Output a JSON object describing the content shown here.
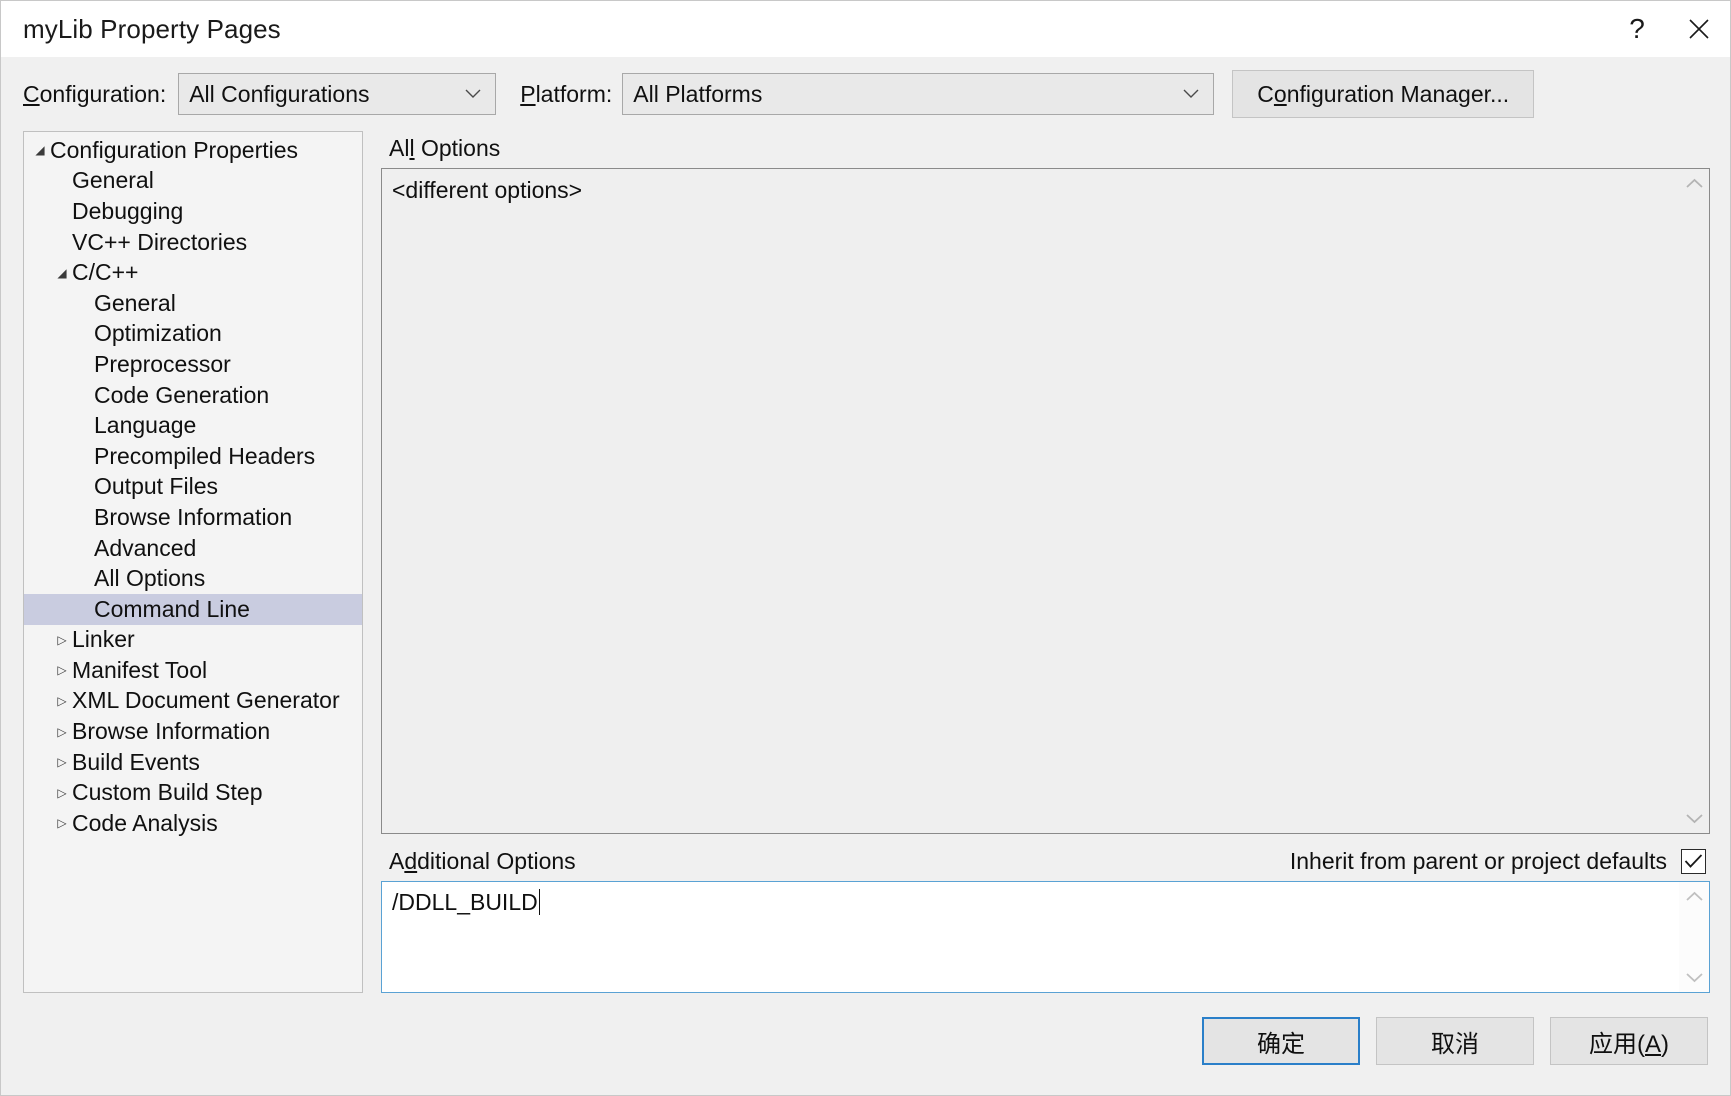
{
  "window": {
    "title": "myLib Property Pages",
    "help_icon": "question-mark-icon",
    "close_icon": "close-icon"
  },
  "config_bar": {
    "configuration_label": "Configuration:",
    "configuration_label_acc": "C",
    "configuration_value": "All Configurations",
    "platform_label": "Platform:",
    "platform_label_acc": "P",
    "platform_value": "All Platforms",
    "configuration_manager_label_pre": "C",
    "configuration_manager_label_acc": "o",
    "configuration_manager_label_post": "nfiguration Manager...",
    "dropdown_icon": "chevron-down-icon"
  },
  "tree": {
    "items": [
      {
        "label": "Configuration Properties",
        "indent": 0,
        "state": "expanded",
        "selected": false
      },
      {
        "label": "General",
        "indent": 1,
        "state": "leaf",
        "selected": false
      },
      {
        "label": "Debugging",
        "indent": 1,
        "state": "leaf",
        "selected": false
      },
      {
        "label": "VC++ Directories",
        "indent": 1,
        "state": "leaf",
        "selected": false
      },
      {
        "label": "C/C++",
        "indent": 1,
        "state": "expanded",
        "selected": false
      },
      {
        "label": "General",
        "indent": 2,
        "state": "leaf",
        "selected": false
      },
      {
        "label": "Optimization",
        "indent": 2,
        "state": "leaf",
        "selected": false
      },
      {
        "label": "Preprocessor",
        "indent": 2,
        "state": "leaf",
        "selected": false
      },
      {
        "label": "Code Generation",
        "indent": 2,
        "state": "leaf",
        "selected": false
      },
      {
        "label": "Language",
        "indent": 2,
        "state": "leaf",
        "selected": false
      },
      {
        "label": "Precompiled Headers",
        "indent": 2,
        "state": "leaf",
        "selected": false
      },
      {
        "label": "Output Files",
        "indent": 2,
        "state": "leaf",
        "selected": false
      },
      {
        "label": "Browse Information",
        "indent": 2,
        "state": "leaf",
        "selected": false
      },
      {
        "label": "Advanced",
        "indent": 2,
        "state": "leaf",
        "selected": false
      },
      {
        "label": "All Options",
        "indent": 2,
        "state": "leaf",
        "selected": false
      },
      {
        "label": "Command Line",
        "indent": 2,
        "state": "leaf",
        "selected": true
      },
      {
        "label": "Linker",
        "indent": 1,
        "state": "collapsed",
        "selected": false
      },
      {
        "label": "Manifest Tool",
        "indent": 1,
        "state": "collapsed",
        "selected": false
      },
      {
        "label": "XML Document Generator",
        "indent": 1,
        "state": "collapsed",
        "selected": false
      },
      {
        "label": "Browse Information",
        "indent": 1,
        "state": "collapsed",
        "selected": false
      },
      {
        "label": "Build Events",
        "indent": 1,
        "state": "collapsed",
        "selected": false
      },
      {
        "label": "Custom Build Step",
        "indent": 1,
        "state": "collapsed",
        "selected": false
      },
      {
        "label": "Code Analysis",
        "indent": 1,
        "state": "collapsed",
        "selected": false
      }
    ],
    "glyph_expanded": "◢",
    "glyph_collapsed": "▷"
  },
  "all_options": {
    "label_pre": "Al",
    "label_acc": "l",
    "label_post": " Options",
    "value": "<different options>",
    "scroll_up_icon": "chevron-up-icon",
    "scroll_down_icon": "chevron-down-icon"
  },
  "additional_options": {
    "label_pre": "A",
    "label_acc": "d",
    "label_post": "ditional Options",
    "value": "/DDLL_BUILD",
    "inherit_label": "Inherit from parent or project defaults",
    "inherit_checked": true,
    "check_icon": "checkmark-icon",
    "scroll_up_icon": "chevron-up-icon",
    "scroll_down_icon": "chevron-down-icon"
  },
  "footer": {
    "ok_label": "确定",
    "cancel_label": "取消",
    "apply_label_pre": "应用(",
    "apply_label_acc": "A",
    "apply_label_post": ")"
  },
  "colors": {
    "accent": "#2a7fc9",
    "selection": "#c9cce0",
    "focus_border": "#5aa2d4",
    "dialog_bg": "#f0f0f0"
  }
}
